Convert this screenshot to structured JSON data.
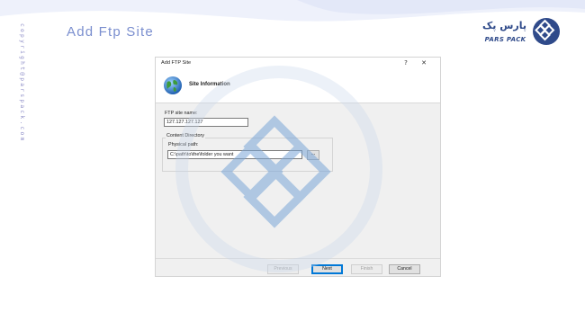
{
  "page": {
    "title": "Add Ftp Site",
    "vertical_credit": "copyright@parspack.com"
  },
  "brand": {
    "name_fa": "پارس پک",
    "name_en": "PARS PACK",
    "color": "#2f4a8a"
  },
  "dialog": {
    "title": "Add FTP Site",
    "help_label": "?",
    "close_label": "✕",
    "header": "Site Information",
    "ftp_site_name_label": "FTP site name:",
    "ftp_site_name_value": "127.127.127.127",
    "content_directory_label": "Content Directory",
    "physical_path_label": "Physical path:",
    "physical_path_value": "C:\\path\\to\\the\\folder you want",
    "browse_label": "...",
    "buttons": {
      "previous": "Previous",
      "next": "Next",
      "finish": "Finish",
      "cancel": "Cancel"
    }
  },
  "colors": {
    "title": "#7b8fcf",
    "accent": "#0078d7",
    "watermark": "#7aa6d8"
  }
}
